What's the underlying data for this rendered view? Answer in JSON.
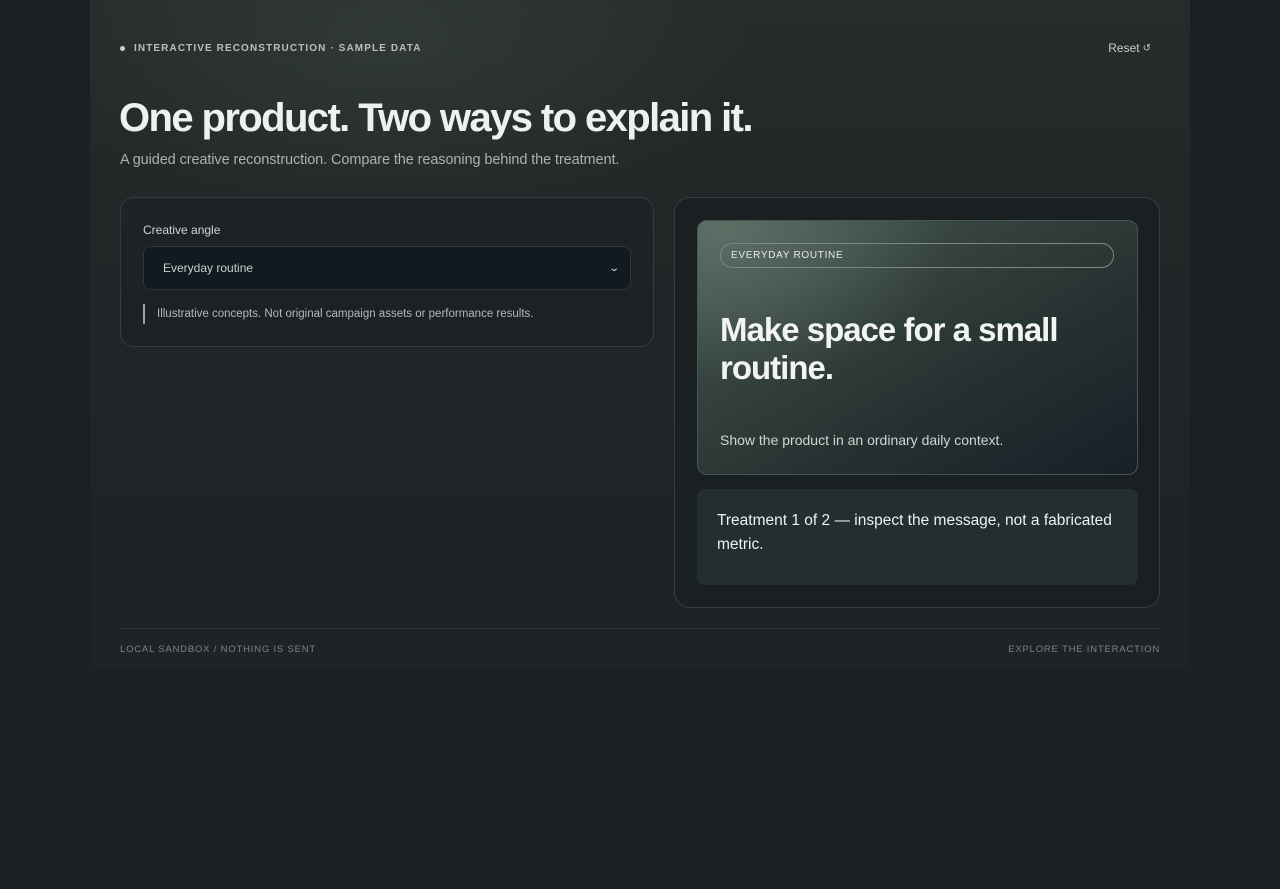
{
  "header": {
    "eyebrow": "INTERACTIVE RECONSTRUCTION · SAMPLE DATA",
    "reset_label": "Reset",
    "reset_icon": "reset-icon",
    "title": "One product. Two ways to explain it.",
    "subtitle": "A guided creative reconstruction. Compare the reasoning behind the treatment."
  },
  "controls": {
    "label": "Creative angle",
    "selected": "Everyday routine",
    "note": "Illustrative concepts. Not original campaign assets or performance results."
  },
  "preview": {
    "tag": "EVERYDAY ROUTINE",
    "headline": "Make space for a small routine.",
    "caption": "Show the product in an ordinary daily context.",
    "treatment_text": "Treatment 1 of 2 — inspect the message, not a fabricated metric."
  },
  "footer": {
    "left": "LOCAL SANDBOX / NOTHING IS SENT",
    "right": "EXPLORE THE INTERACTION"
  }
}
